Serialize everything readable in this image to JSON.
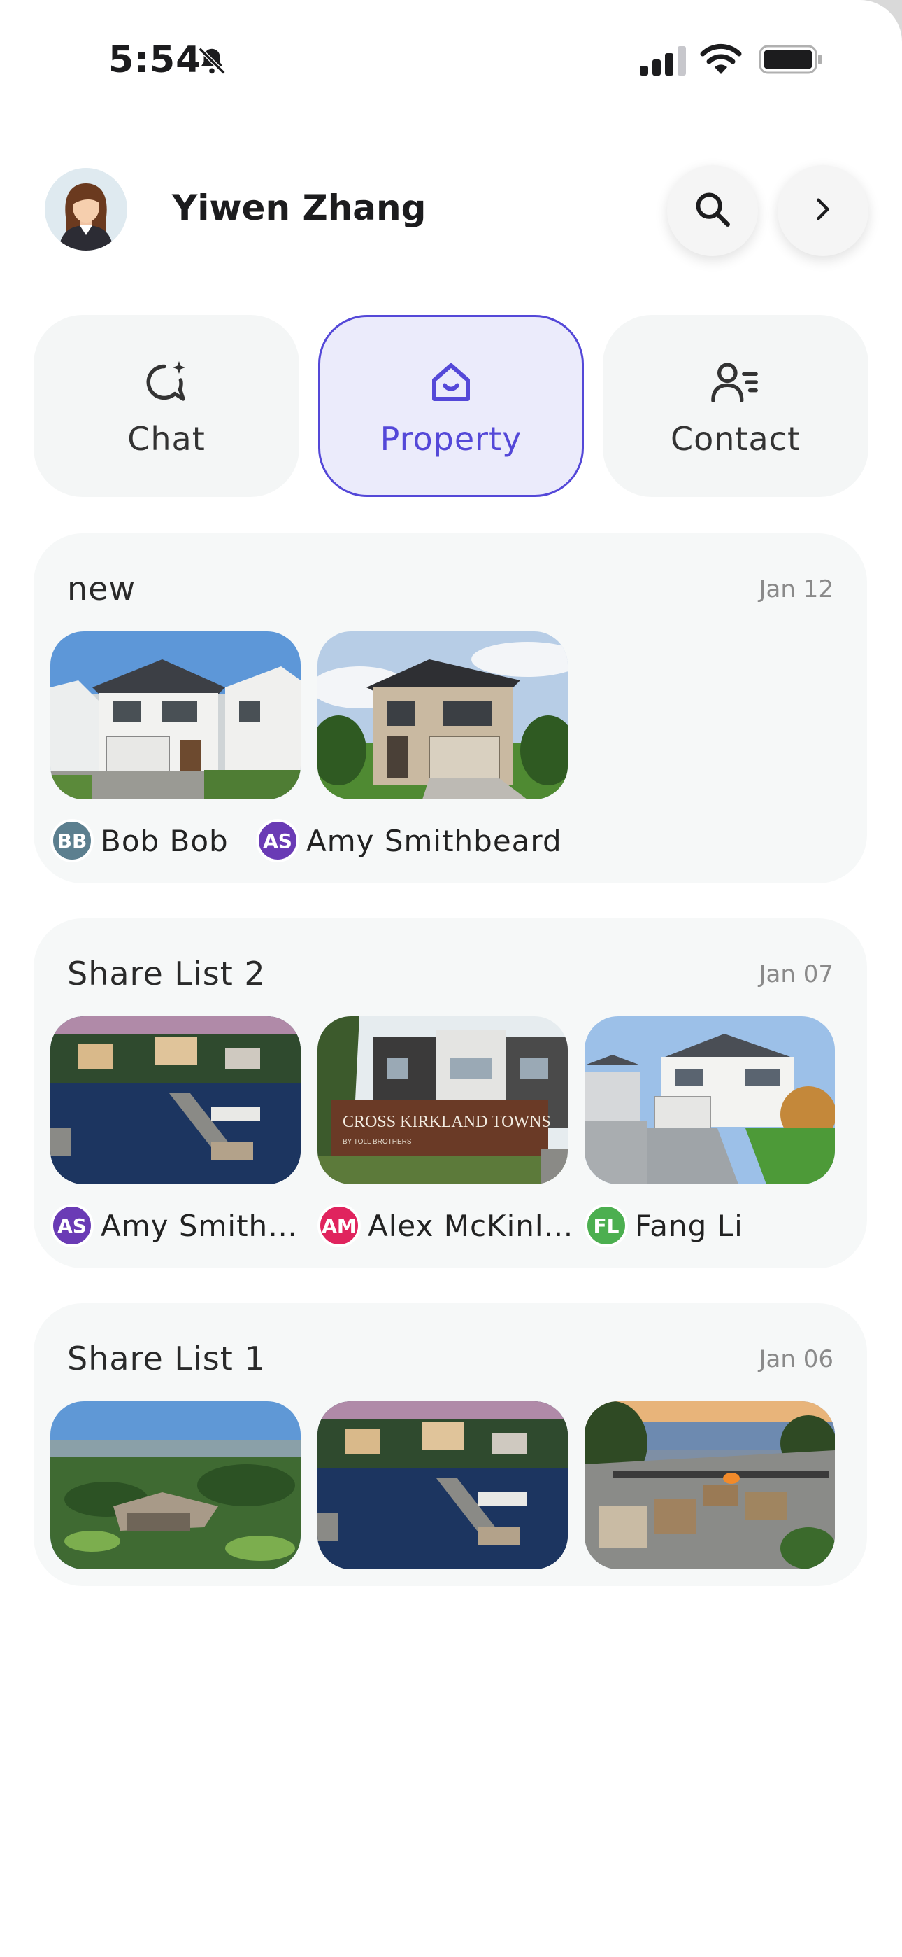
{
  "status_bar": {
    "time": "5:54"
  },
  "header": {
    "user_name": "Yiwen Zhang"
  },
  "tabs": [
    {
      "label": "Chat",
      "icon": "chat-sparkle-icon"
    },
    {
      "label": "Property",
      "icon": "home-icon",
      "selected": true
    },
    {
      "label": "Contact",
      "icon": "contact-list-icon"
    }
  ],
  "colors": {
    "accent": "#5448d8",
    "card_bg": "#f6f8f8"
  },
  "lists": [
    {
      "title": "new",
      "date": "Jan 12",
      "sharers": [
        {
          "initials": "BB",
          "name": "Bob Bob",
          "color": "#5c7f8f"
        },
        {
          "initials": "AS",
          "name": "Amy Smithbeard",
          "color": "#6a3bb5"
        }
      ]
    },
    {
      "title": "Share List 2",
      "date": "Jan 07",
      "sign_text": "CROSS KIRKLAND TOWNS",
      "sign_subtext": "BY TOLL BROTHERS",
      "sharers": [
        {
          "initials": "AS",
          "name": "Amy Smith…",
          "color": "#6a3bb5"
        },
        {
          "initials": "AM",
          "name": "Alex McKinl…",
          "color": "#e0245e"
        },
        {
          "initials": "FL",
          "name": "Fang Li",
          "color": "#4caf50"
        }
      ]
    },
    {
      "title": "Share List 1",
      "date": "Jan 06"
    }
  ]
}
